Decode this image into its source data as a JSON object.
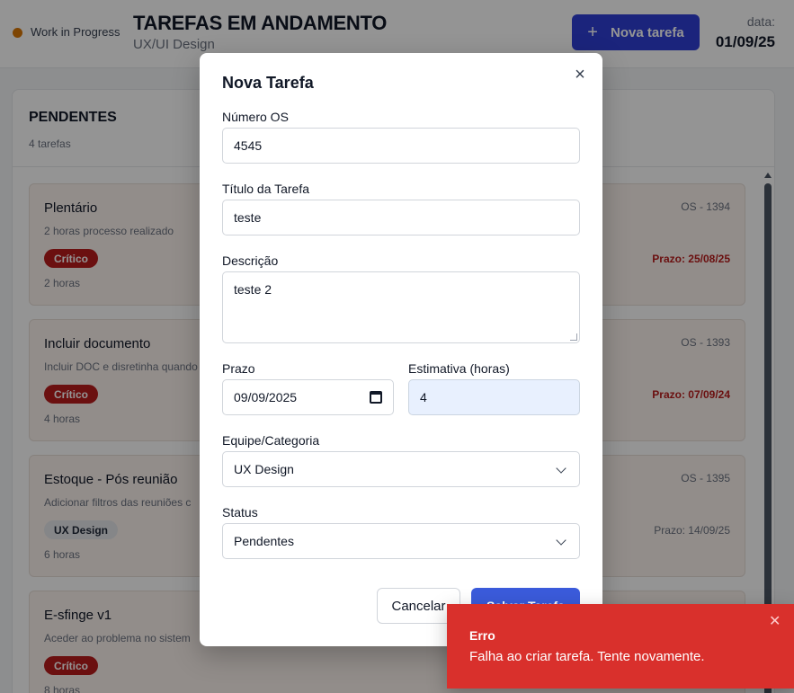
{
  "header": {
    "status": "Work in Progress",
    "title": "TAREFAS EM ANDAMENTO",
    "subtitle": "UX/UI Design",
    "new_task_label": "Nova tarefa",
    "date_label": "data:",
    "date_value": "01/09/25",
    "status_color": "#d97706",
    "accent_color": "#2f3fd6"
  },
  "column": {
    "title": "PENDENTES",
    "count": "4 tarefas",
    "cards": [
      {
        "title": "Plentário",
        "description": "2 horas processo realizado",
        "badge": "Crítico",
        "badge_type": "critical",
        "hours": "2 horas",
        "os": "OS - 1394",
        "deadline": "Prazo: 25/08/25",
        "deadline_overdue": true
      },
      {
        "title": "Incluir documento",
        "description": "Incluir DOC e disretinha quando",
        "badge": "Crítico",
        "badge_type": "critical",
        "hours": "4 horas",
        "os": "OS - 1393",
        "deadline": "Prazo: 07/09/24",
        "deadline_overdue": true
      },
      {
        "title": "Estoque - Pós reunião",
        "description": "Adicionar filtros das reuniões c",
        "badge": "UX Design",
        "badge_type": "team",
        "hours": "6 horas",
        "os": "OS - 1395",
        "deadline": "Prazo: 14/09/25",
        "deadline_overdue": false
      },
      {
        "title": "E-sfinge v1",
        "description": "Aceder ao problema no sistem",
        "badge": "Crítico",
        "badge_type": "critical",
        "hours": "8 horas",
        "os": "",
        "deadline": "",
        "deadline_overdue": false
      }
    ]
  },
  "modal": {
    "title": "Nova Tarefa",
    "fields": {
      "os_number": {
        "label": "Número OS",
        "value": "4545"
      },
      "task_title": {
        "label": "Título da Tarefa",
        "value": "teste"
      },
      "description": {
        "label": "Descrição",
        "value": "teste 2"
      },
      "deadline": {
        "label": "Prazo",
        "value": "09/09/2025"
      },
      "estimate": {
        "label": "Estimativa (horas)",
        "value": "4"
      },
      "team": {
        "label": "Equipe/Categoria",
        "value": "UX Design"
      },
      "status": {
        "label": "Status",
        "value": "Pendentes"
      }
    },
    "cancel_label": "Cancelar",
    "save_label": "Salvar Tarefa"
  },
  "toast": {
    "title": "Erro",
    "message": "Falha ao criar tarefa. Tente novamente.",
    "color": "#d9302c"
  }
}
